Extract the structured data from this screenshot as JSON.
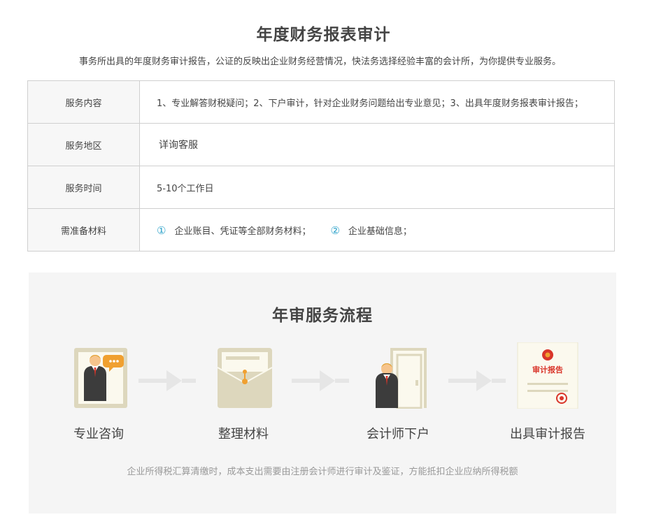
{
  "header": {
    "title": "年度财务报表审计",
    "subtitle": "事务所出具的年度财务审计报告，公证的反映出企业财务经营情况，快法务选择经验丰富的会计所，为你提供专业服务。"
  },
  "info_table": {
    "rows": [
      {
        "label": "服务内容",
        "value": "1、专业解答财税疑问；2、下户审计，针对企业财务问题给出专业意见；3、出具年度财务报表审计报告；"
      },
      {
        "label": "服务地区",
        "value": "详询客服"
      },
      {
        "label": "服务时间",
        "value": "5-10个工作日"
      },
      {
        "label": "需准备材料"
      }
    ],
    "materials": [
      {
        "num": "①",
        "text": "企业账目、凭证等全部财务材料；"
      },
      {
        "num": "②",
        "text": "企业基础信息；"
      }
    ]
  },
  "flow": {
    "title": "年审服务流程",
    "steps": [
      {
        "label": "专业咨询",
        "icon": "consultant-icon"
      },
      {
        "label": "整理材料",
        "icon": "folder-icon"
      },
      {
        "label": "会计师下户",
        "icon": "accountant-door-icon"
      },
      {
        "label": "出具审计报告",
        "icon": "audit-report-icon"
      }
    ],
    "report_icon_text": "审计报告",
    "note": "企业所得税汇算清缴时，成本支出需要由注册会计师进行审计及鉴证，方能抵扣企业应纳所得税额"
  },
  "colors": {
    "accent_number": "#2aa1c9",
    "report_red": "#d9352a",
    "icon_tan": "#ddd7bd",
    "icon_cream": "#fbf9ee",
    "suit_dark": "#3c3c3c",
    "panel_bg": "#f5f5f5"
  }
}
